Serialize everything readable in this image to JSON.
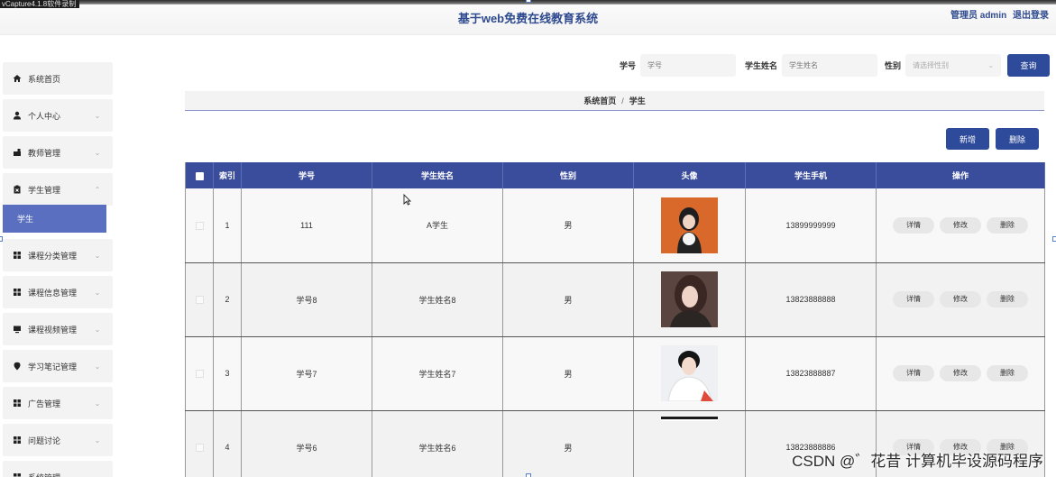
{
  "capture_label": "vCapture4.1.8软件录制",
  "header": {
    "title": "基于web免费在线教育系统",
    "user": "管理员 admin",
    "logout": "退出登录"
  },
  "sidebar": {
    "items": [
      {
        "label": "系统首页",
        "icon": "home-icon",
        "chevron": false
      },
      {
        "label": "个人中心",
        "icon": "user-icon",
        "chevron": true
      },
      {
        "label": "教师管理",
        "icon": "teacher-icon",
        "chevron": true
      },
      {
        "label": "学生管理",
        "icon": "clipboard-icon",
        "chevron": true,
        "expanded": true
      },
      {
        "label": "课程分类管理",
        "icon": "grid-icon",
        "chevron": true
      },
      {
        "label": "课程信息管理",
        "icon": "grid-icon",
        "chevron": true
      },
      {
        "label": "课程视频管理",
        "icon": "monitor-icon",
        "chevron": true
      },
      {
        "label": "学习笔记管理",
        "icon": "pin-icon",
        "chevron": true
      },
      {
        "label": "广告管理",
        "icon": "grid-icon",
        "chevron": true
      },
      {
        "label": "问题讨论",
        "icon": "grid-icon",
        "chevron": true
      },
      {
        "label": "系统管理",
        "icon": "grid-icon",
        "chevron": true
      }
    ],
    "active_sub": "学生"
  },
  "search": {
    "xuehao_label": "学号",
    "xuehao_placeholder": "学号",
    "name_label": "学生姓名",
    "name_placeholder": "学生姓名",
    "gender_label": "性别",
    "gender_placeholder": "请选择性别",
    "query_button": "查询"
  },
  "breadcrumb": {
    "home": "系统首页",
    "separator": "/",
    "current": "学生"
  },
  "actions": {
    "add": "新增",
    "delete": "删除"
  },
  "table": {
    "columns": [
      "索引",
      "学号",
      "学生姓名",
      "性别",
      "头像",
      "学生手机",
      "操作"
    ],
    "rows": [
      {
        "index": "1",
        "xuehao": "111",
        "name": "A学生",
        "gender": "男",
        "phone": "13899999999"
      },
      {
        "index": "2",
        "xuehao": "学号8",
        "name": "学生姓名8",
        "gender": "男",
        "phone": "13823888888"
      },
      {
        "index": "3",
        "xuehao": "学号7",
        "name": "学生姓名7",
        "gender": "男",
        "phone": "13823888887"
      },
      {
        "index": "4",
        "xuehao": "学号6",
        "name": "学生姓名6",
        "gender": "男",
        "phone": "13823888886"
      }
    ],
    "ops": {
      "detail": "详情",
      "edit": "修改",
      "delete": "删除"
    }
  },
  "watermark": "CSDN @゛花昔 计算机毕设源码程序",
  "colors": {
    "primary": "#2e4a9a",
    "header_row": "#3a4d9c",
    "active_menu": "#5a6fc0"
  }
}
